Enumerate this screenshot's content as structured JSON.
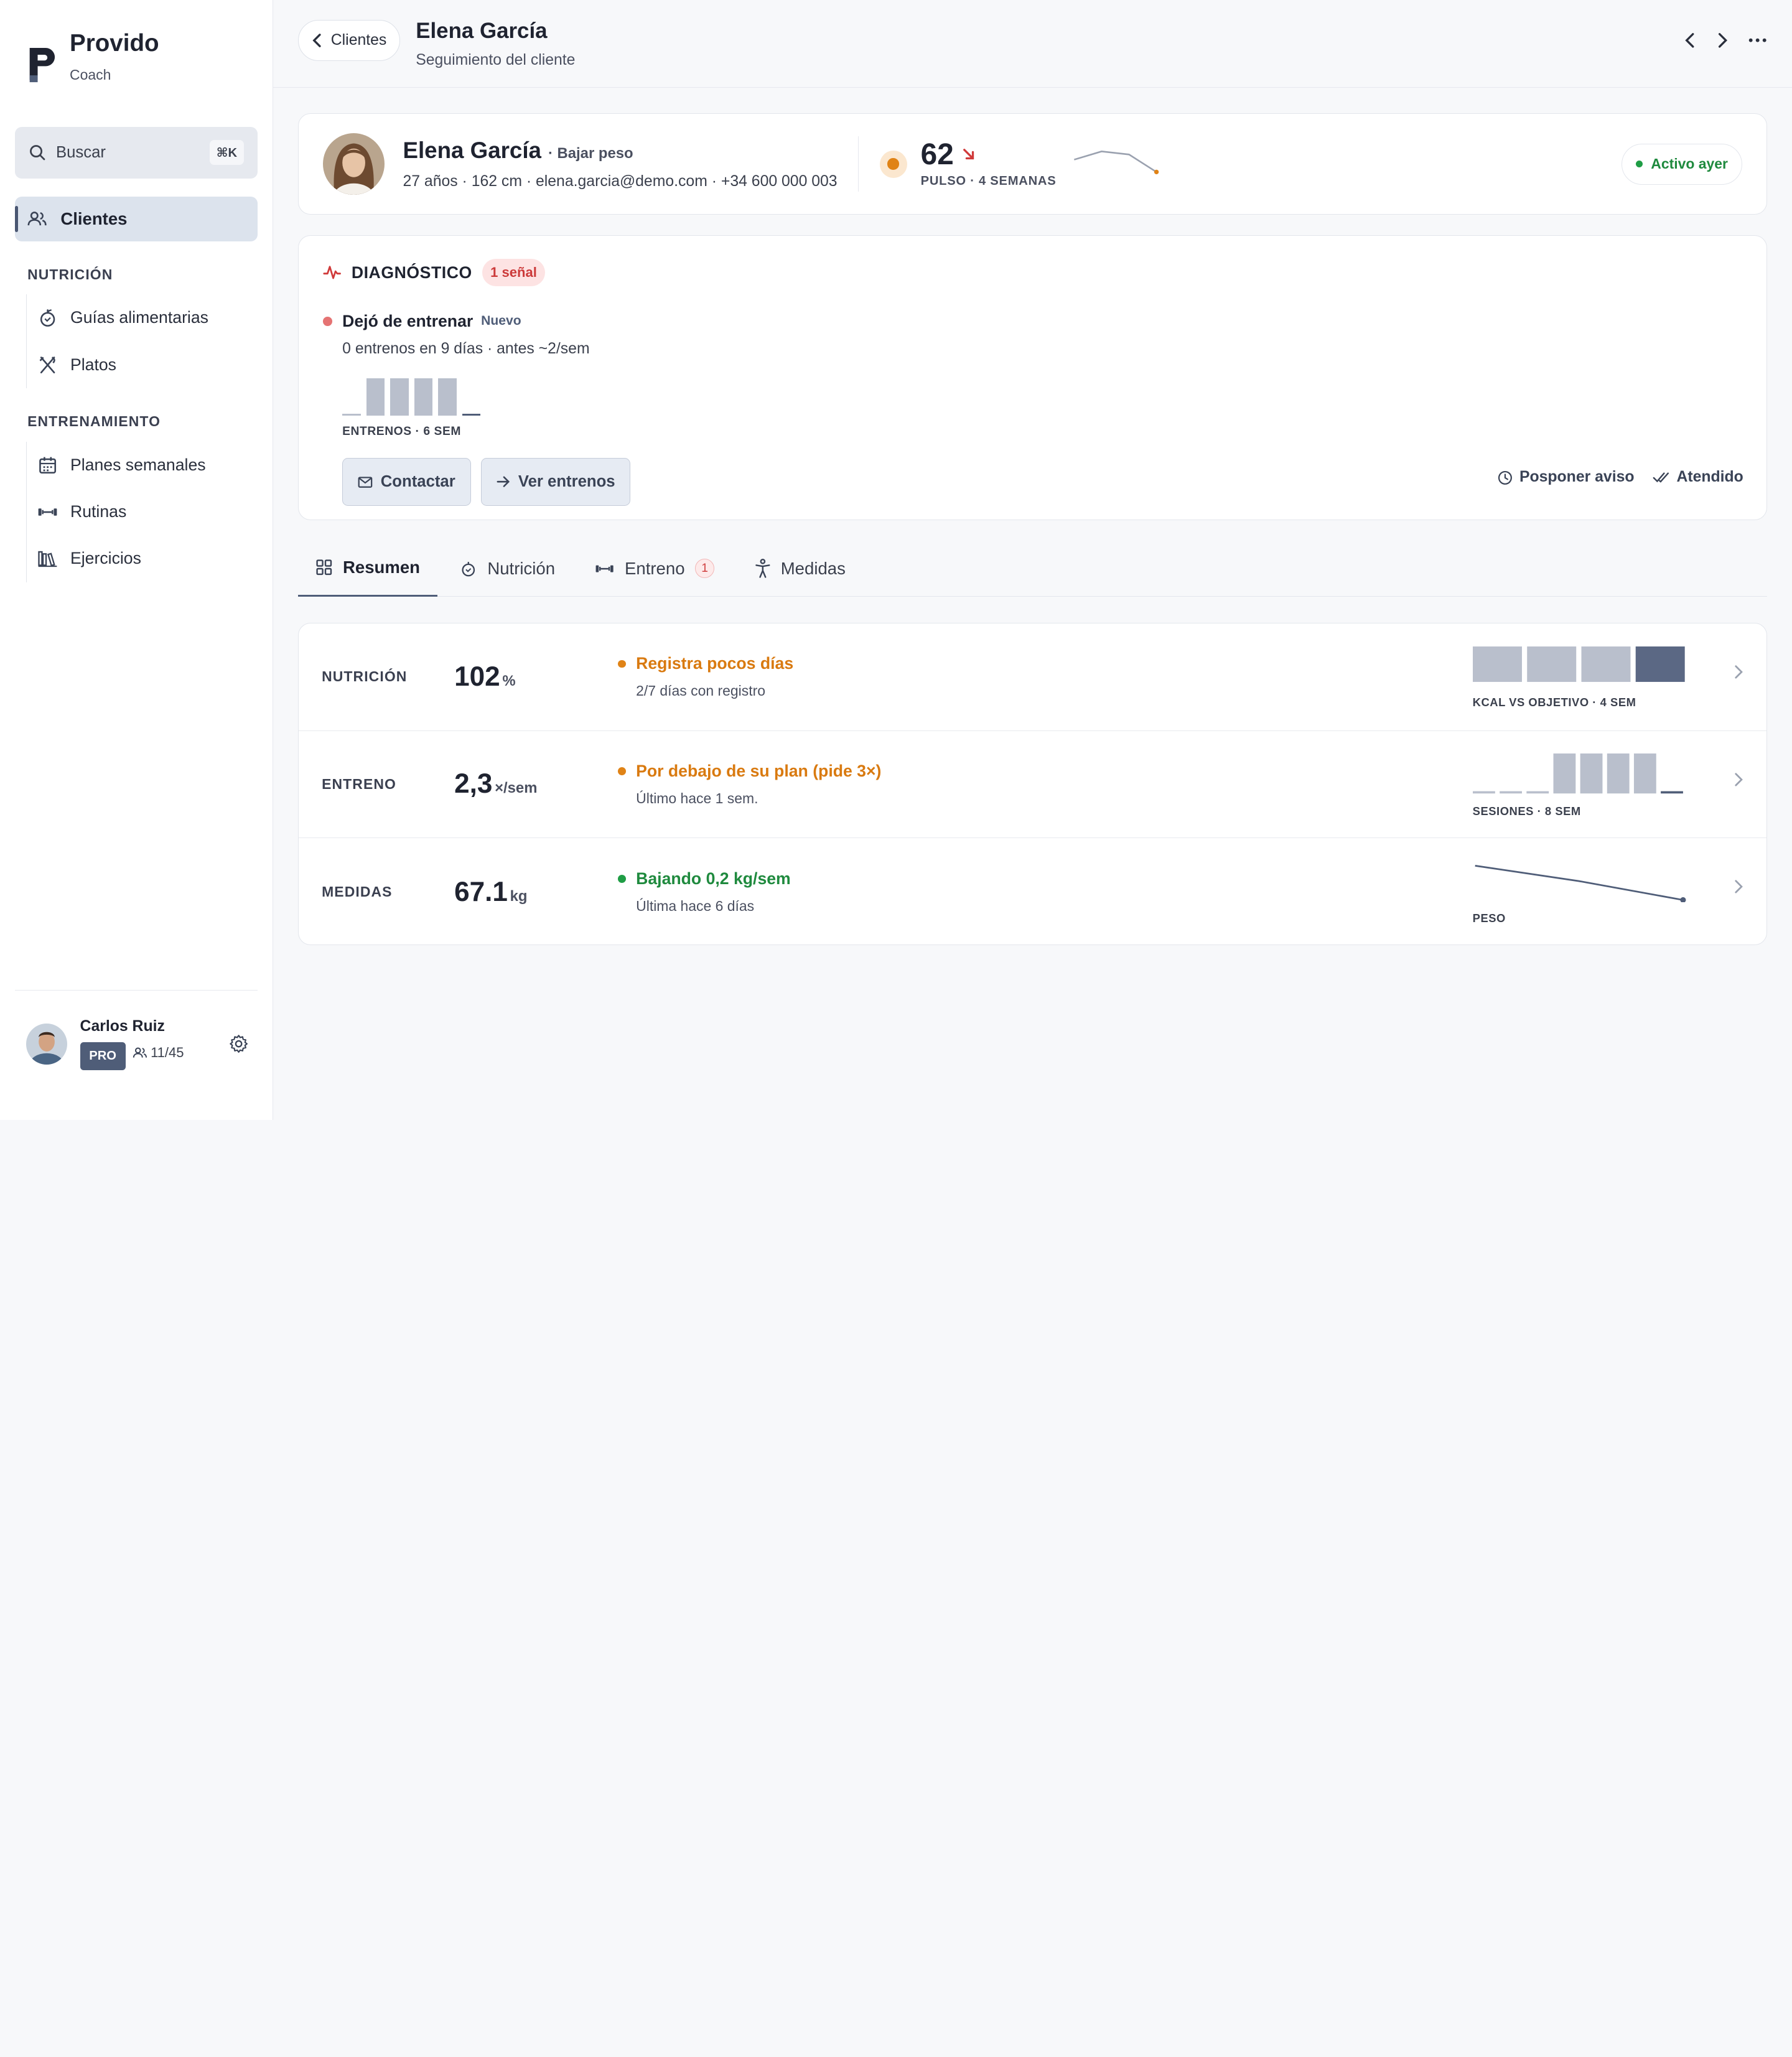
{
  "brand": {
    "name": "Provido",
    "sub": "Coach"
  },
  "search": {
    "placeholder": "Buscar",
    "shortcut": "⌘K"
  },
  "nav": {
    "active": "Clientes",
    "sections": [
      {
        "title": "NUTRICIÓN",
        "items": [
          "Guías alimentarias",
          "Platos"
        ]
      },
      {
        "title": "ENTRENAMIENTO",
        "items": [
          "Planes semanales",
          "Rutinas",
          "Ejercicios"
        ]
      }
    ]
  },
  "user": {
    "name": "Carlos Ruiz",
    "plan": "PRO",
    "clients": "11/45"
  },
  "topbar": {
    "back_label": "Clientes",
    "title": "Elena García",
    "subtitle": "Seguimiento del cliente"
  },
  "profile": {
    "name": "Elena García",
    "goal": "· Bajar peso",
    "info": "27 años · 162 cm · elena.garcia@demo.com · +34 600 000 003",
    "pulse_value": "62",
    "pulse_label": "PULSO · 4 SEMANAS",
    "pulse_trend": [
      0.6,
      1.0,
      0.85,
      0.0
    ],
    "status": "Activo ayer",
    "status_color": "#1f9d45"
  },
  "diagnostic": {
    "title": "DIAGNÓSTICO",
    "badge": "1 señal",
    "signal_title": "Dejó de entrenar",
    "signal_tag": "Nuevo",
    "signal_sub": "0 entrenos en 9 días · antes ~2/sem",
    "weekly_sessions": [
      0,
      2,
      2,
      2,
      2,
      0
    ],
    "mini_label": "ENTRENOS · 6 SEM",
    "btn_contact": "Contactar",
    "btn_view": "Ver entrenos",
    "postpone": "Posponer aviso",
    "done": "Atendido"
  },
  "tabs": [
    {
      "label": "Resumen",
      "icon": "grid-icon"
    },
    {
      "label": "Nutrición",
      "icon": "apple-icon"
    },
    {
      "label": "Entreno",
      "icon": "dumbbell-icon",
      "count": "1"
    },
    {
      "label": "Medidas",
      "icon": "body-icon"
    }
  ],
  "metrics": [
    {
      "label": "NUTRICIÓN",
      "value": "102",
      "unit": "%",
      "status": "Registra pocos días",
      "status_color": "#d97a10",
      "sub": "2/7 días con registro",
      "chart_label": "KCAL VS OBJETIVO · 4 SEM",
      "bars": [
        1,
        1,
        1,
        1
      ]
    },
    {
      "label": "ENTRENO",
      "value": "2,3",
      "unit": "×/sem",
      "status": "Por debajo de su plan (pide 3×)",
      "status_color": "#d97a10",
      "sub": "Último hace 1 sem.",
      "chart_label": "SESIONES · 8 SEM",
      "bars": [
        0,
        0,
        0,
        2,
        2,
        2,
        2,
        0
      ]
    },
    {
      "label": "MEDIDAS",
      "value": "67.1",
      "unit": "kg",
      "status": "Bajando 0,2 kg/sem",
      "status_color": "#1f8a3e",
      "sub": "Última hace 6 días",
      "chart_label": "PESO",
      "trend": [
        1.0,
        0.55,
        0.0
      ]
    }
  ],
  "colors": {
    "accent": "#4f5d78",
    "bar": "#b9bfcc",
    "warning": "#d97a10",
    "danger": "#cc3a3a",
    "success": "#1f8a3e"
  }
}
